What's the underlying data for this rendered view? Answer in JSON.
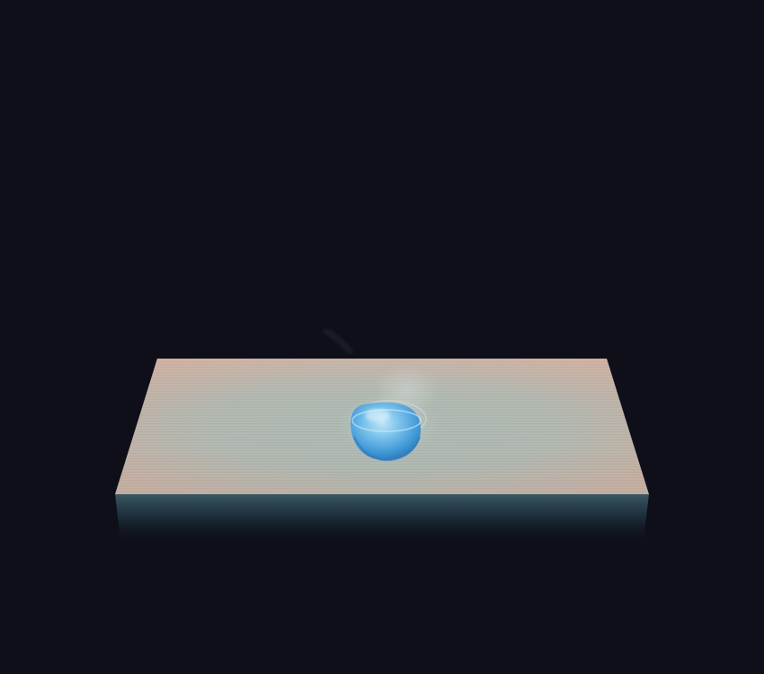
{
  "scene": {
    "subject": "3d-render",
    "colors": {
      "background": "#0e0f19",
      "plane_center": "#a9b6b0",
      "plane_edge": "#cfae9f",
      "plane_front_edge": "#9fb0ab",
      "underside_top": "#3b5a66",
      "underside_bottom": "#0f1622",
      "droplet_light": "#9fd8f5",
      "droplet_mid": "#4aa8e3",
      "droplet_dark": "#2b6fae"
    }
  }
}
